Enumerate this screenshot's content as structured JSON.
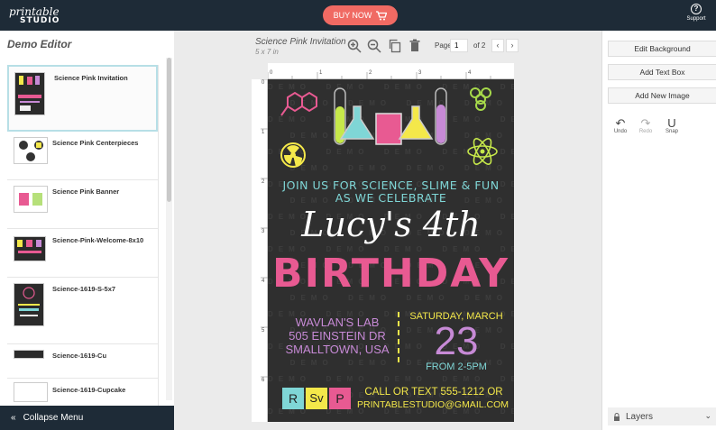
{
  "header": {
    "logo_line1": "printable",
    "logo_line2": "STUDIO",
    "buy_label": "BUY NOW",
    "support_label": "Support"
  },
  "sidebar": {
    "title": "Demo Editor",
    "items": [
      {
        "label": "Science Pink Invitation"
      },
      {
        "label": "Science Pink Centerpieces"
      },
      {
        "label": "Science Pink Banner"
      },
      {
        "label": "Science-Pink-Welcome-8x10"
      },
      {
        "label": "Science-1619-S-5x7"
      },
      {
        "label": "Science-1619-Cu"
      },
      {
        "label": "Science-1619-Cupcake"
      }
    ],
    "collapse_label": "Collapse Menu"
  },
  "canvas": {
    "title": "Science Pink Invitation",
    "size": "5 x 7 in",
    "page_label": "Page",
    "page_value": "1",
    "page_of": "of 2",
    "ruler_h": [
      "0",
      "1",
      "2",
      "3",
      "4"
    ],
    "ruler_v": [
      "0",
      "1",
      "2",
      "3",
      "4",
      "5",
      "6"
    ]
  },
  "poster": {
    "line1": "JOIN US FOR SCIENCE, SLIME & FUN",
    "line2": "AS WE CELEBRATE",
    "name": "Lucy's 4th",
    "birthday": "BIRTHDAY",
    "addr1": "WAVLAN'S LAB",
    "addr2": "505 EINSTEIN DR",
    "addr3": "SMALLTOWN, USA",
    "date1": "SATURDAY, MARCH",
    "date2": "23",
    "time": "FROM 2-5PM",
    "call1": "CALL OR TEXT 555-1212 OR",
    "call2": "PRINTABLESTUDIO@GMAIL.COM",
    "elements": [
      "R",
      "Sv",
      "P"
    ],
    "watermark": "DEMO"
  },
  "right": {
    "edit_bg": "Edit Background",
    "add_text": "Add Text Box",
    "add_image": "Add New Image",
    "undo": "Undo",
    "redo": "Redo",
    "snap": "Snap",
    "layers": "Layers"
  },
  "colors": {
    "header_bg": "#1e2b37",
    "accent": "#f06a63",
    "pink": "#e85a92",
    "teal": "#7fd6d6",
    "yellow": "#f4e84a",
    "purple": "#c78ad6"
  }
}
